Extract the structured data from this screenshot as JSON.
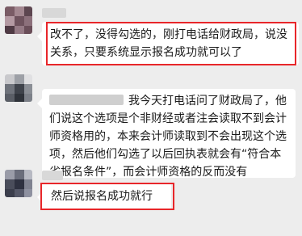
{
  "messages": [
    {
      "lines": [
        "改不了，没得勾选的，刚打电话给财政局，说没",
        "关系，只要系统显示报名成功就可以了"
      ],
      "highlighted": true
    },
    {
      "lines": [
        "我今天打电话问了财政局了，他",
        "们说这个选项是个非财经或者注会读取不到会计",
        "师资格用的，本来会计师读取到不会出现这个选",
        "项，然后他们勾选了以后回执表就会有“符合本",
        "省报名条件”，而会计师资格的反而没有"
      ],
      "has_mention": true,
      "highlighted": false
    },
    {
      "lines": [
        "然后说报名成功就行"
      ],
      "highlighted": true
    }
  ],
  "colors": {
    "background": "#ededed",
    "bubble": "#ffffff",
    "highlight": "#e8262a"
  }
}
